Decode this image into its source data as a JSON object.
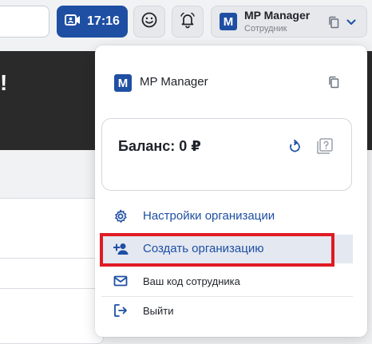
{
  "topbar": {
    "call_time": "17:16",
    "account": {
      "logo_letter": "M",
      "name": "MP Manager",
      "role": "Сотрудник"
    },
    "icons": {
      "call": "video-camera-icon",
      "emoji": "smiley-icon",
      "bell": "bell-icon",
      "copy": "copy-icon",
      "chevron": "chevron-down-icon"
    }
  },
  "background": {
    "banner_text": "!"
  },
  "dropdown": {
    "logo_letter": "M",
    "title": "MP Manager",
    "balance_label": "Баланс: 0 ₽",
    "menu": {
      "settings": "Настройки организации",
      "create": "Создать организацию",
      "code": "Ваш код сотрудника",
      "logout": "Выйти"
    },
    "icons": {
      "copy": "copy-icon",
      "refresh": "refresh-icon",
      "help": "help-icon",
      "settings": "gear-icon",
      "create": "add-user-icon",
      "code": "envelope-icon",
      "logout": "logout-icon"
    }
  },
  "colors": {
    "accent": "#1e4fa3",
    "highlight_border": "#e01b24",
    "selected_bg": "#e4e8f1"
  }
}
